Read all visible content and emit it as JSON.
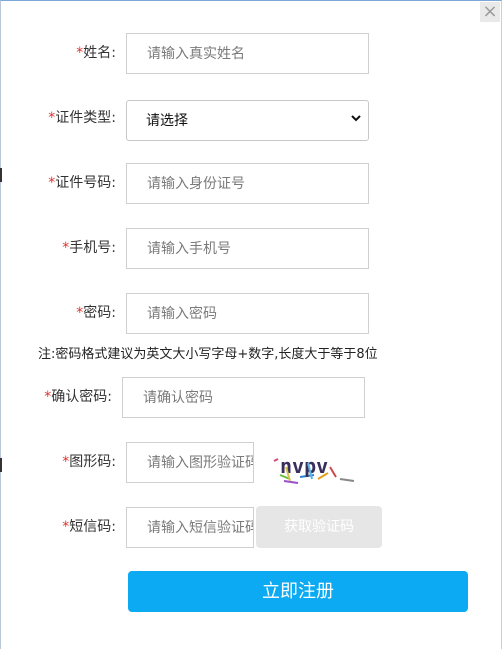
{
  "close_icon": "close-icon",
  "required_mark": "*",
  "fields": {
    "name": {
      "label": "姓名:",
      "placeholder": "请输入真实姓名"
    },
    "id_type": {
      "label": "证件类型:",
      "selected": "请选择"
    },
    "id_number": {
      "label": "证件号码:",
      "placeholder": "请输入身份证号"
    },
    "phone": {
      "label": "手机号:",
      "placeholder": "请输入手机号"
    },
    "password": {
      "label": "密码:",
      "placeholder": "请输入密码"
    },
    "password_note": "注:密码格式建议为英文大小写字母+数字,长度大于等于8位",
    "confirm_password": {
      "label": "确认密码:",
      "placeholder": "请确认密码"
    },
    "captcha": {
      "label": "图形码:",
      "placeholder": "请输入图形验证码",
      "image_text": "nvpv"
    },
    "sms_code": {
      "label": "短信码:",
      "placeholder": "请输入短信验证码",
      "button_label": "获取验证码"
    }
  },
  "submit_label": "立即注册",
  "colors": {
    "accent": "#0baaf2",
    "required": "#e0312c",
    "disabled_button": "#e6e6e6"
  }
}
